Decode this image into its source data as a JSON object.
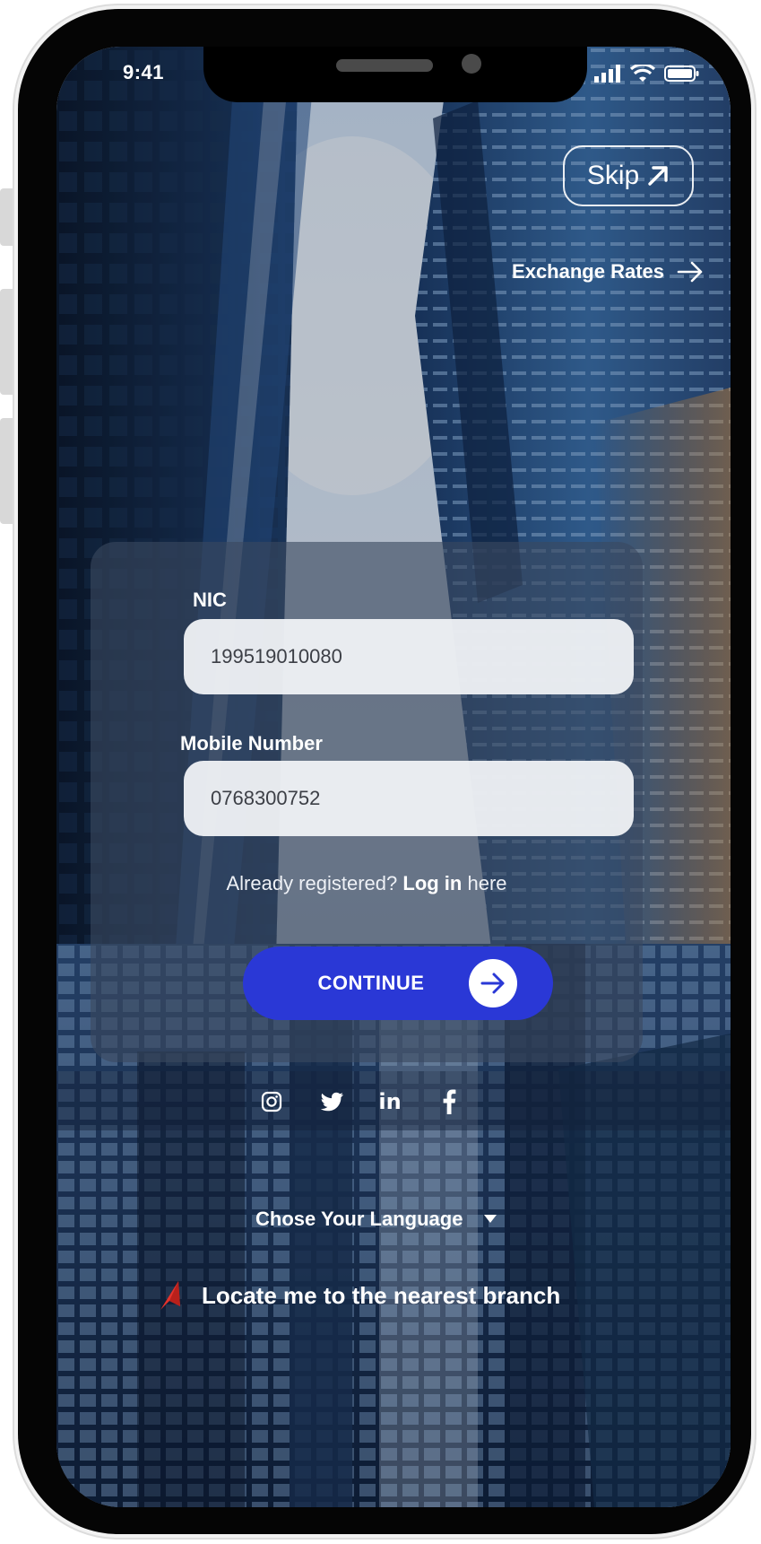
{
  "status_bar": {
    "time": "9:41"
  },
  "header": {
    "skip_label": "Skip",
    "exchange_rates_label": "Exchange Rates"
  },
  "form": {
    "nic_label": "NIC",
    "nic_value": "199519010080",
    "mobile_label": "Mobile Number",
    "mobile_value": "0768300752",
    "already_registered_text": "Already registered?",
    "login_link_text": "Log in",
    "login_suffix_text": "here",
    "continue_label": "CONTINUE"
  },
  "social": {
    "icons": [
      "instagram-icon",
      "twitter-icon",
      "linkedin-icon",
      "facebook-icon"
    ]
  },
  "footer": {
    "language_label": "Chose Your Language",
    "locate_label": "Locate me to the nearest branch"
  },
  "colors": {
    "primary_button": "#2a38d6",
    "locate_arrow": "#e4322b",
    "card_overlay": "#3a4860"
  }
}
